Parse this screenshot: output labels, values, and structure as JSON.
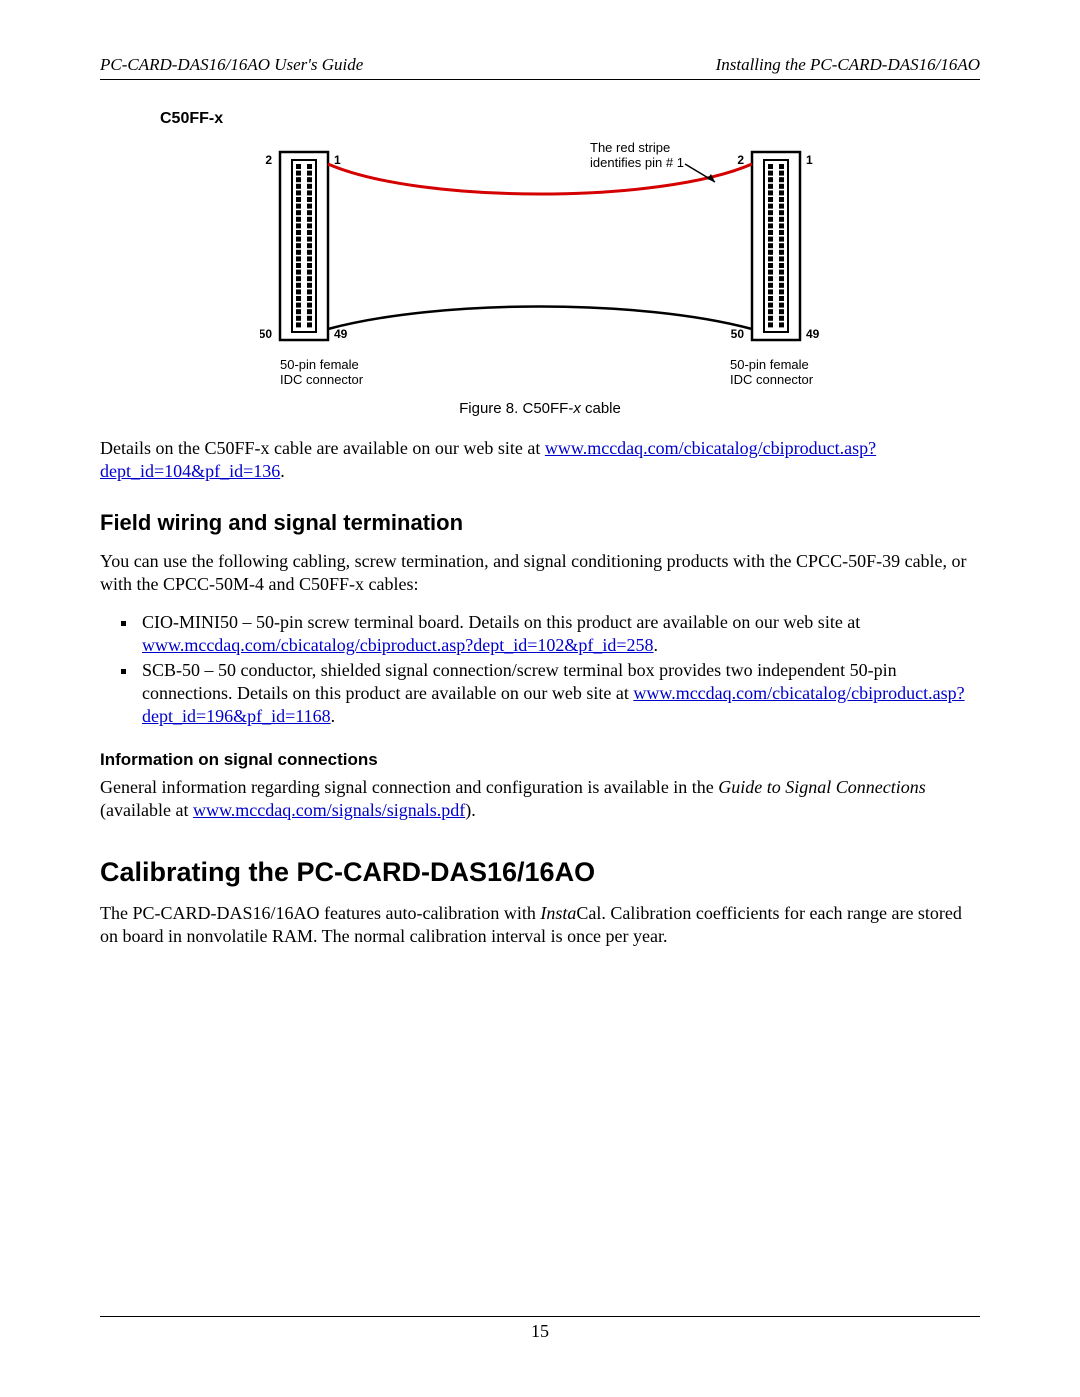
{
  "header": {
    "left": "PC-CARD-DAS16/16AO User's Guide",
    "right": "Installing the PC-CARD-DAS16/16AO"
  },
  "figure": {
    "title": "C50FF-x",
    "stripe_line1": "The red stripe",
    "stripe_line2": "identifies pin # 1",
    "left_pin_top_left": "2",
    "left_pin_top_right": "1",
    "left_pin_bot_left": "50",
    "left_pin_bot_right": "49",
    "right_pin_top_left": "2",
    "right_pin_top_right": "1",
    "right_pin_bot_left": "50",
    "right_pin_bot_right": "49",
    "left_conn_l1": "50-pin female",
    "left_conn_l2": "IDC connector",
    "right_conn_l1": "50-pin female",
    "right_conn_l2": "IDC connector",
    "caption_prefix": "Figure 8. C50FF-",
    "caption_italic": "x",
    "caption_suffix": " cable"
  },
  "para1_a": "Details on the C50FF-x cable are available on our web site at ",
  "para1_link": "www.mccdaq.com/cbicatalog/cbiproduct.asp?dept_id=104&pf_id=136",
  "para1_b": ".",
  "h2_field": "Field wiring and signal termination",
  "para2": "You can use the following cabling, screw termination, and signal conditioning products with the CPCC-50F-39 cable, or with the CPCC-50M-4 and C50FF-x cables:",
  "bullets": {
    "b1_a": "CIO-MINI50 – 50-pin screw terminal board. Details on this product are available on our web site at ",
    "b1_link": "www.mccdaq.com/cbicatalog/cbiproduct.asp?dept_id=102&pf_id=258",
    "b1_b": ".",
    "b2_a": "SCB-50 – 50 conductor, shielded signal connection/screw terminal box provides two independent 50-pin connections. Details on this product are available on our web site at ",
    "b2_link": "www.mccdaq.com/cbicatalog/cbiproduct.asp?dept_id=196&pf_id=1168",
    "b2_b": "."
  },
  "h3_info": "Information on signal connections",
  "para3_a": "General information regarding signal connection and configuration is available in the ",
  "para3_i": "Guide to Signal Connections",
  "para3_b": " (available at ",
  "para3_link": "www.mccdaq.com/signals/signals.pdf",
  "para3_c": ").",
  "h1_cal": "Calibrating the PC-CARD-DAS16/16AO",
  "para4_a": "The PC-CARD-DAS16/16AO features auto-calibration with ",
  "para4_i": "Insta",
  "para4_b": "Cal. Calibration coefficients for each range are stored on board in nonvolatile RAM. The normal calibration interval is once per year.",
  "page_number": "15"
}
